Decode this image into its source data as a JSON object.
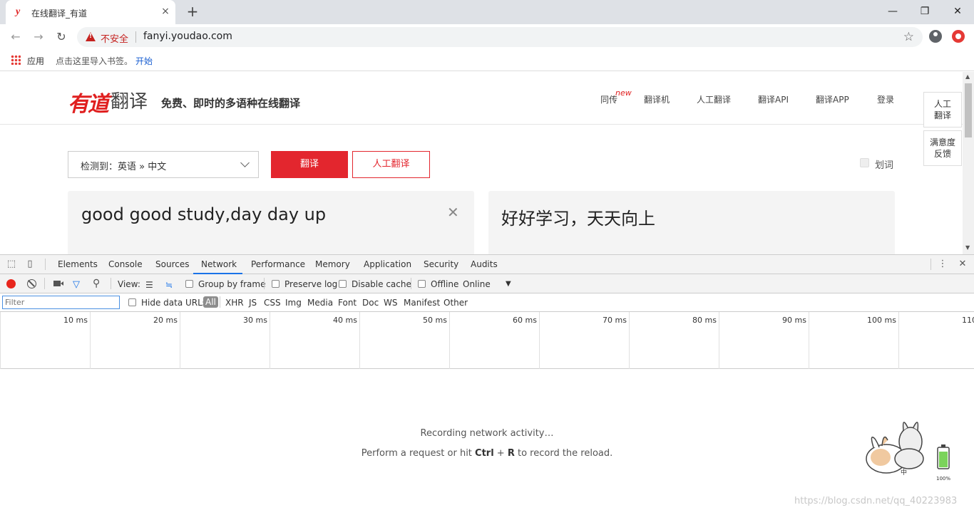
{
  "browser": {
    "tab_title": "在线翻译_有道",
    "tab_favicon": "y",
    "tab_close": "×",
    "new_tab": "+",
    "window": {
      "minimize": "—",
      "restore": "❐",
      "close": "✕"
    },
    "nav": {
      "back": "←",
      "forward": "→",
      "reload": "↻"
    },
    "security_label": "不安全",
    "url": "fanyi.youdao.com",
    "bookmarks": {
      "apps_label": "应用",
      "hint": "点击这里导入书签。",
      "start_link": "开始"
    }
  },
  "site": {
    "logo_brand": "有道",
    "logo_product": "翻译",
    "slogan": "免费、即时的多语种在线翻译",
    "nav": [
      {
        "label": "同传"
      },
      {
        "label": "翻译机"
      },
      {
        "label": "人工翻译"
      },
      {
        "label": "翻译API"
      },
      {
        "label": "翻译APP"
      },
      {
        "label": "登录"
      }
    ],
    "new_badge": "new",
    "side_buttons": [
      {
        "line1": "人工",
        "line2": "翻译"
      },
      {
        "line1": "满意度",
        "line2": "反馈"
      }
    ],
    "language_select": "检测到：英语  »  中文",
    "translate_button": "翻译",
    "human_translate_button": "人工翻译",
    "huaci_label": "划词",
    "input_text": "good good study,day day up",
    "clear_icon": "✕",
    "output_text": "好好学习，天天向上"
  },
  "devtools": {
    "tabs": [
      "Elements",
      "Console",
      "Sources",
      "Network",
      "Performance",
      "Memory",
      "Application",
      "Security",
      "Audits"
    ],
    "active_tab": "Network",
    "menu_icon": "⋮",
    "close_icon": "✕",
    "toolbar": {
      "view_label": "View:",
      "group_by_frame": "Group by frame",
      "preserve_log": "Preserve log",
      "disable_cache": "Disable cache",
      "offline": "Offline",
      "throttle": "Online",
      "throttle_arrow": "▼"
    },
    "filter": {
      "placeholder": "Filter",
      "hide_data_urls": "Hide data URLs",
      "types": [
        "All",
        "XHR",
        "JS",
        "CSS",
        "Img",
        "Media",
        "Font",
        "Doc",
        "WS",
        "Manifest",
        "Other"
      ],
      "active_type": "All"
    },
    "timeline_labels": [
      "10 ms",
      "20 ms",
      "30 ms",
      "40 ms",
      "50 ms",
      "60 ms",
      "70 ms",
      "80 ms",
      "90 ms",
      "100 ms",
      "110"
    ],
    "empty_state": {
      "line1": "Recording network activity…",
      "line2_prefix": "Perform a request or hit ",
      "shortcut_ctrl": "Ctrl",
      "shortcut_plus": " + ",
      "shortcut_key": "R",
      "line2_suffix": " to record the reload."
    },
    "sticker_text": {
      "name": "中",
      "battery": "100%"
    }
  },
  "watermark": "https://blog.csdn.net/qq_40223983",
  "colors": {
    "brand_red": "#e3262e",
    "devtools_blue": "#1a73e8",
    "record_red": "#e8261d"
  }
}
